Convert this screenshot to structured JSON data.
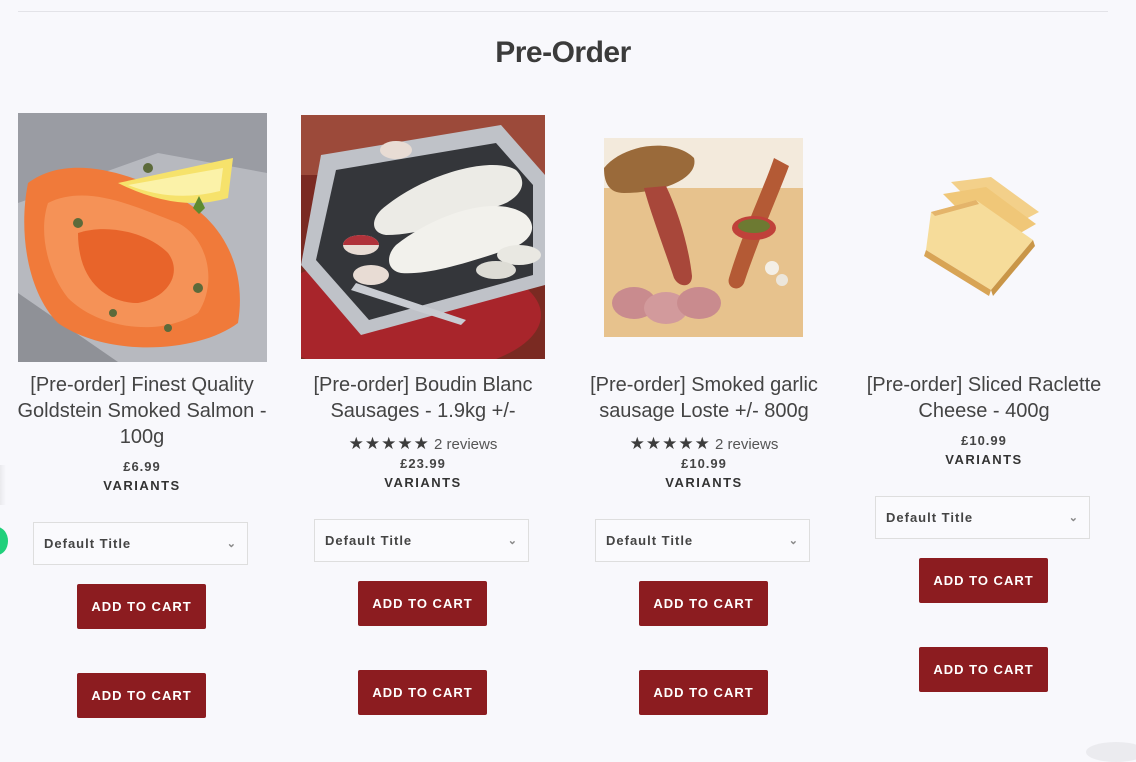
{
  "section": {
    "title": "Pre-Order"
  },
  "products": [
    {
      "title": "[Pre-order] Finest Quality Goldstein Smoked Salmon - 100g",
      "price": "£6.99",
      "variants_label": "VARIANTS",
      "select_value": "Default Title",
      "add_to_cart": "ADD TO CART",
      "add_to_cart_2": "ADD TO CART",
      "image": "smoked-salmon"
    },
    {
      "title": "[Pre-order] Boudin Blanc Sausages - 1.9kg +/-",
      "rating": {
        "stars": "★★★★★",
        "reviews": "2 reviews",
        "value": 5
      },
      "price": "£23.99",
      "variants_label": "VARIANTS",
      "select_value": "Default Title",
      "add_to_cart": "ADD TO CART",
      "add_to_cart_2": "ADD TO CART",
      "image": "boudin-blanc-sausages"
    },
    {
      "title": "[Pre-order] Smoked garlic sausage Loste +/- 800g",
      "rating": {
        "stars": "★★★★★",
        "reviews": "2 reviews",
        "value": 5
      },
      "price": "£10.99",
      "variants_label": "VARIANTS",
      "select_value": "Default Title",
      "add_to_cart": "ADD TO CART",
      "add_to_cart_2": "ADD TO CART",
      "image": "garlic-sausage"
    },
    {
      "title": "[Pre-order] Sliced Raclette Cheese - 400g",
      "price": "£10.99",
      "variants_label": "VARIANTS",
      "select_value": "Default Title",
      "add_to_cart": "ADD TO CART",
      "add_to_cart_2": "ADD TO CART",
      "image": "raclette-cheese"
    }
  ],
  "colors": {
    "accent": "#8c1c20",
    "background": "#f8f8fc",
    "chat_bubble": "#20d07b"
  },
  "icons": {
    "select_chevron": "chevron-down-icon",
    "star": "star-icon"
  }
}
